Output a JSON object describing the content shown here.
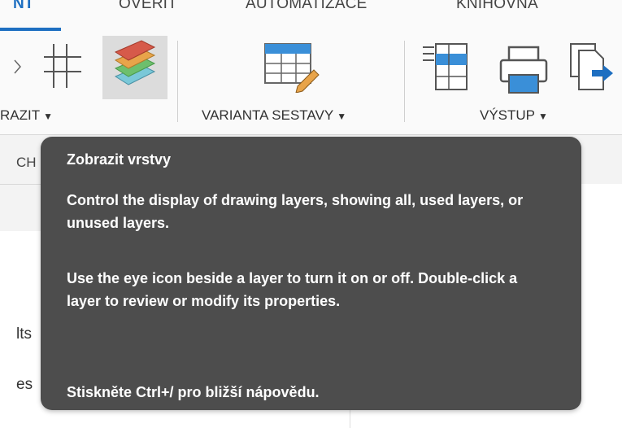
{
  "tabs": [
    {
      "label": "NT",
      "active": true
    },
    {
      "label": "OVĚŘIT",
      "active": false
    },
    {
      "label": "AUTOMATIZACE",
      "active": false
    },
    {
      "label": "KNIHOVNA",
      "active": false
    }
  ],
  "ribbon": {
    "groups": [
      {
        "label": "RAZIT"
      },
      {
        "label": "VARIANTA SESTAVY"
      },
      {
        "label": "VÝSTUP"
      }
    ]
  },
  "panel": {
    "tab_label": "CH",
    "partial_lines": [
      "lts",
      "es"
    ]
  },
  "tooltip": {
    "title": "Zobrazit vrstvy",
    "paragraph1": "Control the display of drawing layers, showing all, used layers, or unused layers.",
    "paragraph2": "Use the eye icon beside a layer to turn it on or off. Double-click a layer to review or modify its properties.",
    "help": "Stiskněte Ctrl+/ pro bližší nápovědu."
  },
  "colors": {
    "accent": "#1e6fc1",
    "tooltip_bg": "#4d4d4d"
  }
}
